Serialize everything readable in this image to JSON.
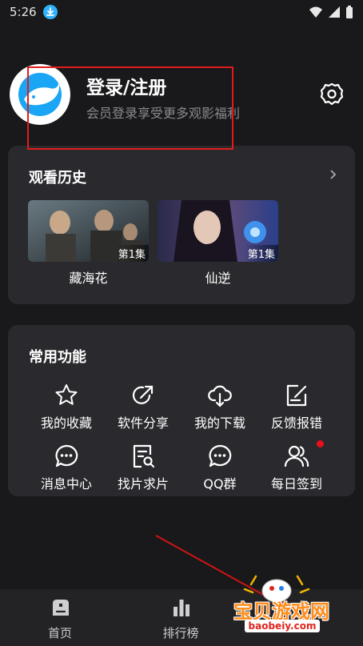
{
  "status_bar": {
    "time": "5:26"
  },
  "profile": {
    "title": "登录/注册",
    "subtitle": "会员登录享受更多观影福利"
  },
  "history": {
    "title": "观看历史",
    "items": [
      {
        "title": "藏海花",
        "episode": "第1集"
      },
      {
        "title": "仙逆",
        "episode": "第1集"
      }
    ]
  },
  "features": {
    "title": "常用功能",
    "items": [
      {
        "label": "我的收藏",
        "icon": "star-icon"
      },
      {
        "label": "软件分享",
        "icon": "share-icon"
      },
      {
        "label": "我的下载",
        "icon": "cloud-download-icon"
      },
      {
        "label": "反馈报错",
        "icon": "feedback-edit-icon"
      },
      {
        "label": "消息中心",
        "icon": "message-icon"
      },
      {
        "label": "找片求片",
        "icon": "search-document-icon"
      },
      {
        "label": "QQ群",
        "icon": "chat-group-icon"
      },
      {
        "label": "每日签到",
        "icon": "users-icon"
      }
    ]
  },
  "tabs": [
    {
      "label": "首页",
      "icon": "home-icon"
    },
    {
      "label": "排行榜",
      "icon": "chart-icon"
    }
  ],
  "watermark": {
    "text": "宝贝游戏网",
    "url": "baobeiy.com"
  },
  "colors": {
    "background": "#19191b",
    "card": "#2a2a2e",
    "annotation": "#e21b1b",
    "accent_blue": "#2fb1ff"
  }
}
